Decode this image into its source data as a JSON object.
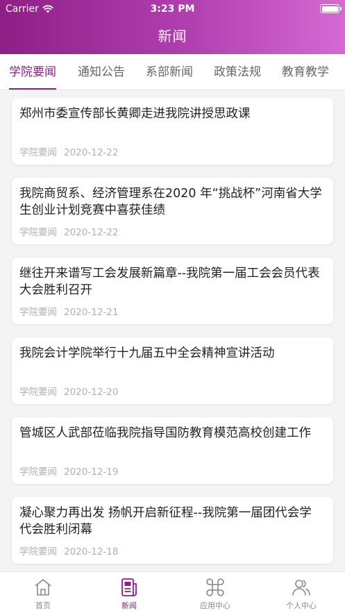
{
  "status_bar": {
    "carrier": "Carrier",
    "time": "3:23 PM"
  },
  "nav": {
    "title": "新闻"
  },
  "tabs": [
    {
      "label": "学院要闻",
      "active": true
    },
    {
      "label": "通知公告",
      "active": false
    },
    {
      "label": "系部新闻",
      "active": false
    },
    {
      "label": "政策法规",
      "active": false
    },
    {
      "label": "教育教学",
      "active": false
    }
  ],
  "news": [
    {
      "title": "郑州市委宣传部长黄卿走进我院讲授思政课",
      "category": "学院要闻",
      "date": "2020-12-22"
    },
    {
      "title": "我院商贸系、经济管理系在2020 年“挑战杯”河南省大学生创业计划竞赛中喜获佳绩",
      "category": "学院要闻",
      "date": "2020-12-22"
    },
    {
      "title": "继往开来谱写工会发展新篇章--我院第一届工会会员代表大会胜利召开",
      "category": "学院要闻",
      "date": "2020-12-21"
    },
    {
      "title": "我院会计学院举行十九届五中全会精神宣讲活动",
      "category": "学院要闻",
      "date": "2020-12-20"
    },
    {
      "title": "管城区人武部莅临我院指导国防教育模范高校创建工作",
      "category": "学院要闻",
      "date": "2020-12-19"
    },
    {
      "title": "凝心聚力再出发 扬帆开启新征程--我院第一届团代会学代会胜利闭幕",
      "category": "学院要闻",
      "date": "2020-12-18"
    }
  ],
  "tabbar": [
    {
      "label": "首页",
      "icon": "home-icon",
      "active": false
    },
    {
      "label": "新闻",
      "icon": "news-icon",
      "active": true
    },
    {
      "label": "应用中心",
      "icon": "command-icon",
      "active": false
    },
    {
      "label": "个人中心",
      "icon": "users-icon",
      "active": false
    }
  ],
  "colors": {
    "accent": "#8f1f86",
    "header_end": "#d56ad3",
    "inactive": "#888888"
  }
}
